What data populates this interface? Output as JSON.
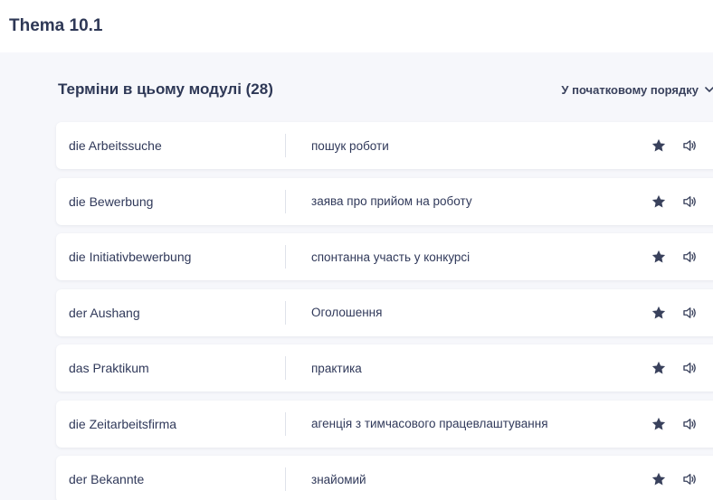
{
  "header": {
    "title": "Thema 10.1"
  },
  "section": {
    "title": "Терміни в цьому модулі (28)",
    "sort_label": "У початковому порядку"
  },
  "terms": [
    {
      "word": "die Arbeitssuche",
      "definition": "пошук роботи"
    },
    {
      "word": "die Bewerbung",
      "definition": "заява про прийом на роботу"
    },
    {
      "word": "die Initiativbewerbung",
      "definition": "спонтанна участь у конкурсі"
    },
    {
      "word": "der Aushang",
      "definition": "Оголошення"
    },
    {
      "word": "das Praktikum",
      "definition": "практика"
    },
    {
      "word": "die Zeitarbeitsfirma",
      "definition": "агенція з тимчасового працевлаштування"
    },
    {
      "word": "der Bekannte",
      "definition": "знайомий"
    }
  ],
  "icons": {
    "star": "star-icon",
    "audio": "speaker-icon",
    "sort": "chevron-down-icon"
  },
  "colors": {
    "text_dark": "#2e3856",
    "icon": "#39415c",
    "background": "#f6f7fb",
    "card": "#ffffff"
  }
}
